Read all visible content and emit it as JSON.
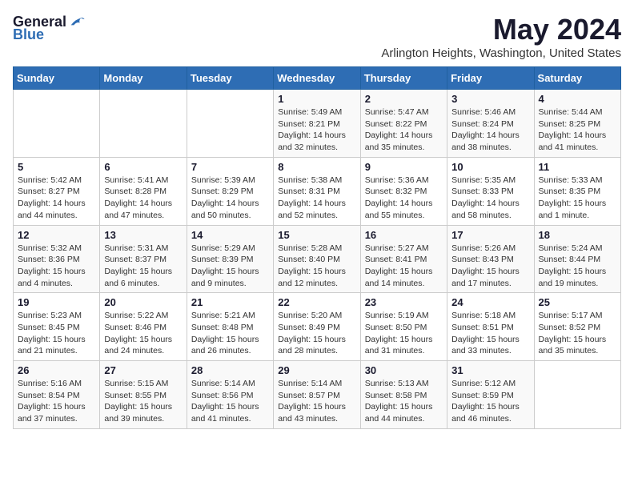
{
  "header": {
    "logo_general": "General",
    "logo_blue": "Blue",
    "month_year": "May 2024",
    "location": "Arlington Heights, Washington, United States"
  },
  "days_of_week": [
    "Sunday",
    "Monday",
    "Tuesday",
    "Wednesday",
    "Thursday",
    "Friday",
    "Saturday"
  ],
  "weeks": [
    [
      {
        "day": "",
        "sunrise": "",
        "sunset": "",
        "daylight": ""
      },
      {
        "day": "",
        "sunrise": "",
        "sunset": "",
        "daylight": ""
      },
      {
        "day": "",
        "sunrise": "",
        "sunset": "",
        "daylight": ""
      },
      {
        "day": "1",
        "sunrise": "Sunrise: 5:49 AM",
        "sunset": "Sunset: 8:21 PM",
        "daylight": "Daylight: 14 hours and 32 minutes."
      },
      {
        "day": "2",
        "sunrise": "Sunrise: 5:47 AM",
        "sunset": "Sunset: 8:22 PM",
        "daylight": "Daylight: 14 hours and 35 minutes."
      },
      {
        "day": "3",
        "sunrise": "Sunrise: 5:46 AM",
        "sunset": "Sunset: 8:24 PM",
        "daylight": "Daylight: 14 hours and 38 minutes."
      },
      {
        "day": "4",
        "sunrise": "Sunrise: 5:44 AM",
        "sunset": "Sunset: 8:25 PM",
        "daylight": "Daylight: 14 hours and 41 minutes."
      }
    ],
    [
      {
        "day": "5",
        "sunrise": "Sunrise: 5:42 AM",
        "sunset": "Sunset: 8:27 PM",
        "daylight": "Daylight: 14 hours and 44 minutes."
      },
      {
        "day": "6",
        "sunrise": "Sunrise: 5:41 AM",
        "sunset": "Sunset: 8:28 PM",
        "daylight": "Daylight: 14 hours and 47 minutes."
      },
      {
        "day": "7",
        "sunrise": "Sunrise: 5:39 AM",
        "sunset": "Sunset: 8:29 PM",
        "daylight": "Daylight: 14 hours and 50 minutes."
      },
      {
        "day": "8",
        "sunrise": "Sunrise: 5:38 AM",
        "sunset": "Sunset: 8:31 PM",
        "daylight": "Daylight: 14 hours and 52 minutes."
      },
      {
        "day": "9",
        "sunrise": "Sunrise: 5:36 AM",
        "sunset": "Sunset: 8:32 PM",
        "daylight": "Daylight: 14 hours and 55 minutes."
      },
      {
        "day": "10",
        "sunrise": "Sunrise: 5:35 AM",
        "sunset": "Sunset: 8:33 PM",
        "daylight": "Daylight: 14 hours and 58 minutes."
      },
      {
        "day": "11",
        "sunrise": "Sunrise: 5:33 AM",
        "sunset": "Sunset: 8:35 PM",
        "daylight": "Daylight: 15 hours and 1 minute."
      }
    ],
    [
      {
        "day": "12",
        "sunrise": "Sunrise: 5:32 AM",
        "sunset": "Sunset: 8:36 PM",
        "daylight": "Daylight: 15 hours and 4 minutes."
      },
      {
        "day": "13",
        "sunrise": "Sunrise: 5:31 AM",
        "sunset": "Sunset: 8:37 PM",
        "daylight": "Daylight: 15 hours and 6 minutes."
      },
      {
        "day": "14",
        "sunrise": "Sunrise: 5:29 AM",
        "sunset": "Sunset: 8:39 PM",
        "daylight": "Daylight: 15 hours and 9 minutes."
      },
      {
        "day": "15",
        "sunrise": "Sunrise: 5:28 AM",
        "sunset": "Sunset: 8:40 PM",
        "daylight": "Daylight: 15 hours and 12 minutes."
      },
      {
        "day": "16",
        "sunrise": "Sunrise: 5:27 AM",
        "sunset": "Sunset: 8:41 PM",
        "daylight": "Daylight: 15 hours and 14 minutes."
      },
      {
        "day": "17",
        "sunrise": "Sunrise: 5:26 AM",
        "sunset": "Sunset: 8:43 PM",
        "daylight": "Daylight: 15 hours and 17 minutes."
      },
      {
        "day": "18",
        "sunrise": "Sunrise: 5:24 AM",
        "sunset": "Sunset: 8:44 PM",
        "daylight": "Daylight: 15 hours and 19 minutes."
      }
    ],
    [
      {
        "day": "19",
        "sunrise": "Sunrise: 5:23 AM",
        "sunset": "Sunset: 8:45 PM",
        "daylight": "Daylight: 15 hours and 21 minutes."
      },
      {
        "day": "20",
        "sunrise": "Sunrise: 5:22 AM",
        "sunset": "Sunset: 8:46 PM",
        "daylight": "Daylight: 15 hours and 24 minutes."
      },
      {
        "day": "21",
        "sunrise": "Sunrise: 5:21 AM",
        "sunset": "Sunset: 8:48 PM",
        "daylight": "Daylight: 15 hours and 26 minutes."
      },
      {
        "day": "22",
        "sunrise": "Sunrise: 5:20 AM",
        "sunset": "Sunset: 8:49 PM",
        "daylight": "Daylight: 15 hours and 28 minutes."
      },
      {
        "day": "23",
        "sunrise": "Sunrise: 5:19 AM",
        "sunset": "Sunset: 8:50 PM",
        "daylight": "Daylight: 15 hours and 31 minutes."
      },
      {
        "day": "24",
        "sunrise": "Sunrise: 5:18 AM",
        "sunset": "Sunset: 8:51 PM",
        "daylight": "Daylight: 15 hours and 33 minutes."
      },
      {
        "day": "25",
        "sunrise": "Sunrise: 5:17 AM",
        "sunset": "Sunset: 8:52 PM",
        "daylight": "Daylight: 15 hours and 35 minutes."
      }
    ],
    [
      {
        "day": "26",
        "sunrise": "Sunrise: 5:16 AM",
        "sunset": "Sunset: 8:54 PM",
        "daylight": "Daylight: 15 hours and 37 minutes."
      },
      {
        "day": "27",
        "sunrise": "Sunrise: 5:15 AM",
        "sunset": "Sunset: 8:55 PM",
        "daylight": "Daylight: 15 hours and 39 minutes."
      },
      {
        "day": "28",
        "sunrise": "Sunrise: 5:14 AM",
        "sunset": "Sunset: 8:56 PM",
        "daylight": "Daylight: 15 hours and 41 minutes."
      },
      {
        "day": "29",
        "sunrise": "Sunrise: 5:14 AM",
        "sunset": "Sunset: 8:57 PM",
        "daylight": "Daylight: 15 hours and 43 minutes."
      },
      {
        "day": "30",
        "sunrise": "Sunrise: 5:13 AM",
        "sunset": "Sunset: 8:58 PM",
        "daylight": "Daylight: 15 hours and 44 minutes."
      },
      {
        "day": "31",
        "sunrise": "Sunrise: 5:12 AM",
        "sunset": "Sunset: 8:59 PM",
        "daylight": "Daylight: 15 hours and 46 minutes."
      },
      {
        "day": "",
        "sunrise": "",
        "sunset": "",
        "daylight": ""
      }
    ]
  ]
}
